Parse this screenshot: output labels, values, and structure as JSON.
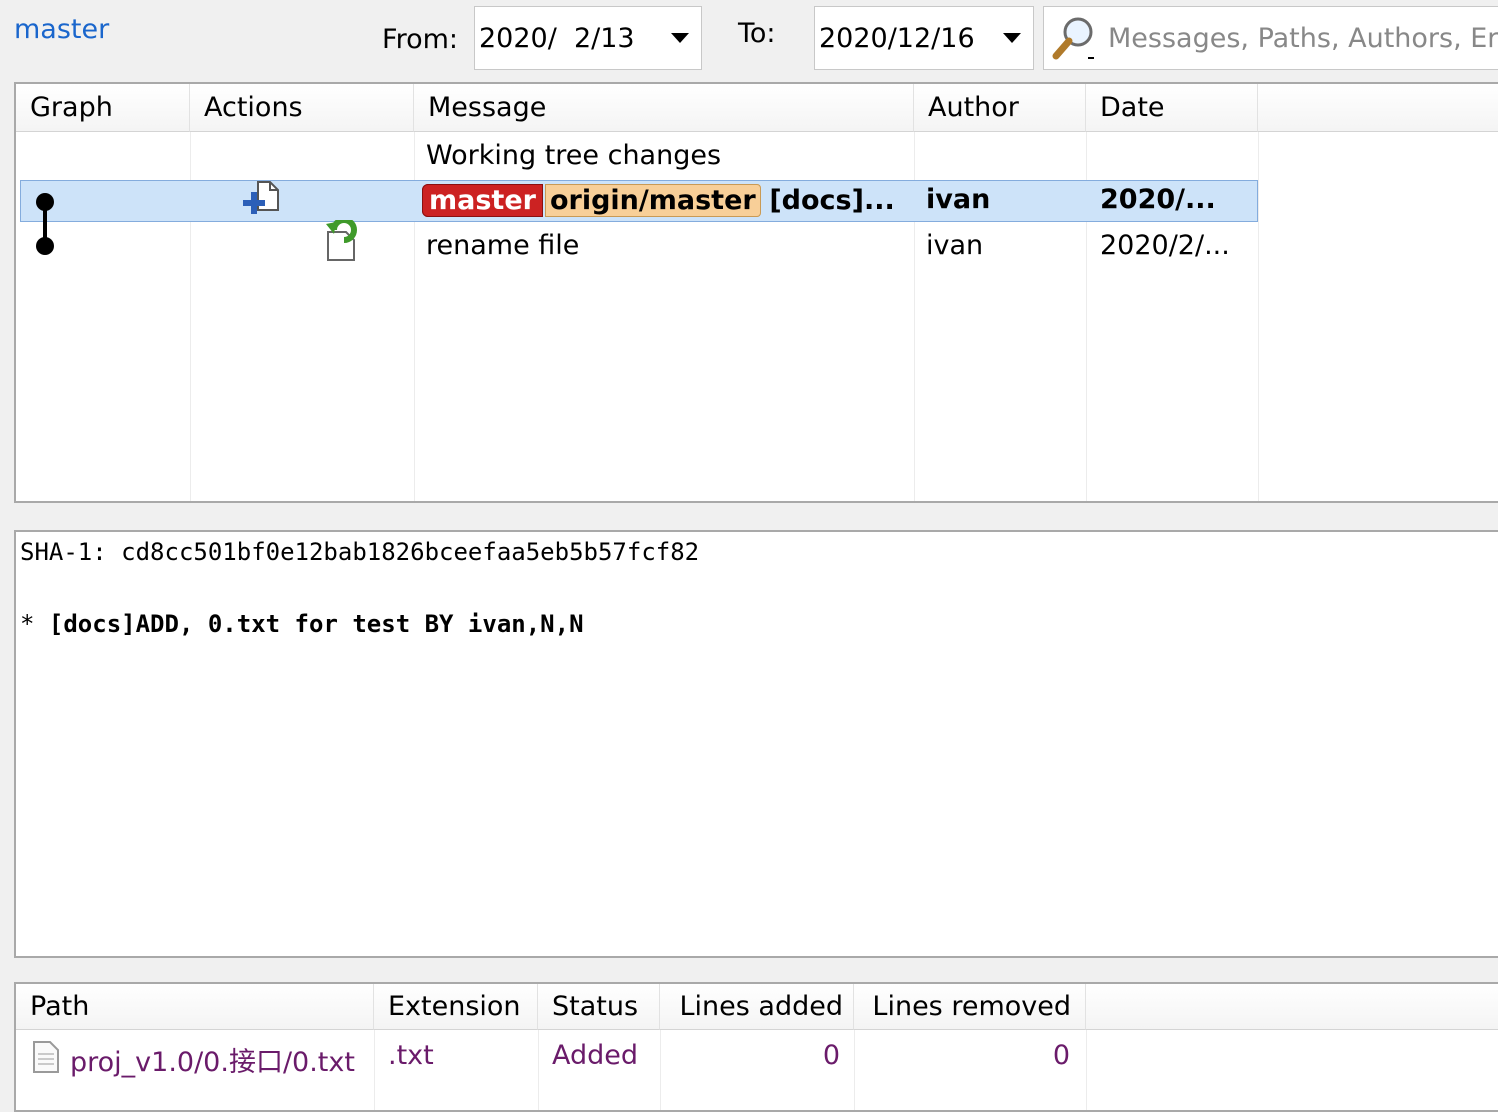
{
  "filter": {
    "branch": "master",
    "from_label": "From:",
    "from_value": "2020/  2/13",
    "to_label": "To:",
    "to_value": "2020/12/16",
    "search_placeholder": "Messages, Paths, Authors, Er"
  },
  "log": {
    "columns": [
      "Graph",
      "Actions",
      "Message",
      "Author",
      "Date"
    ],
    "working_tree_row": "Working tree changes",
    "rows": [
      {
        "refs": [
          "master",
          "origin/master"
        ],
        "message": "[docs]...",
        "author": "ivan",
        "date": "2020/...",
        "action_icon": "commit-add-icon",
        "selected": true
      },
      {
        "message": "rename file",
        "author": "ivan",
        "date": "2020/2/...",
        "action_icon": "revert-icon",
        "selected": false
      }
    ]
  },
  "detail": {
    "sha_line": "SHA-1: cd8cc501bf0e12bab1826bceefaa5eb5b57fcf82",
    "bullet": "*",
    "message": "[docs]ADD, 0.txt for test BY ivan,N,N"
  },
  "files": {
    "columns": [
      "Path",
      "Extension",
      "Status",
      "Lines added",
      "Lines removed"
    ],
    "rows": [
      {
        "path": "proj_v1.0/0.接口/0.txt",
        "extension": ".txt",
        "status": "Added",
        "lines_added": "0",
        "lines_removed": "0"
      }
    ]
  },
  "colors": {
    "link": "#1a66cc",
    "selection": "#cde3f9",
    "master_ref": "#cc2222",
    "origin_ref": "#f8cf98",
    "file_path": "#6a1b6a"
  }
}
